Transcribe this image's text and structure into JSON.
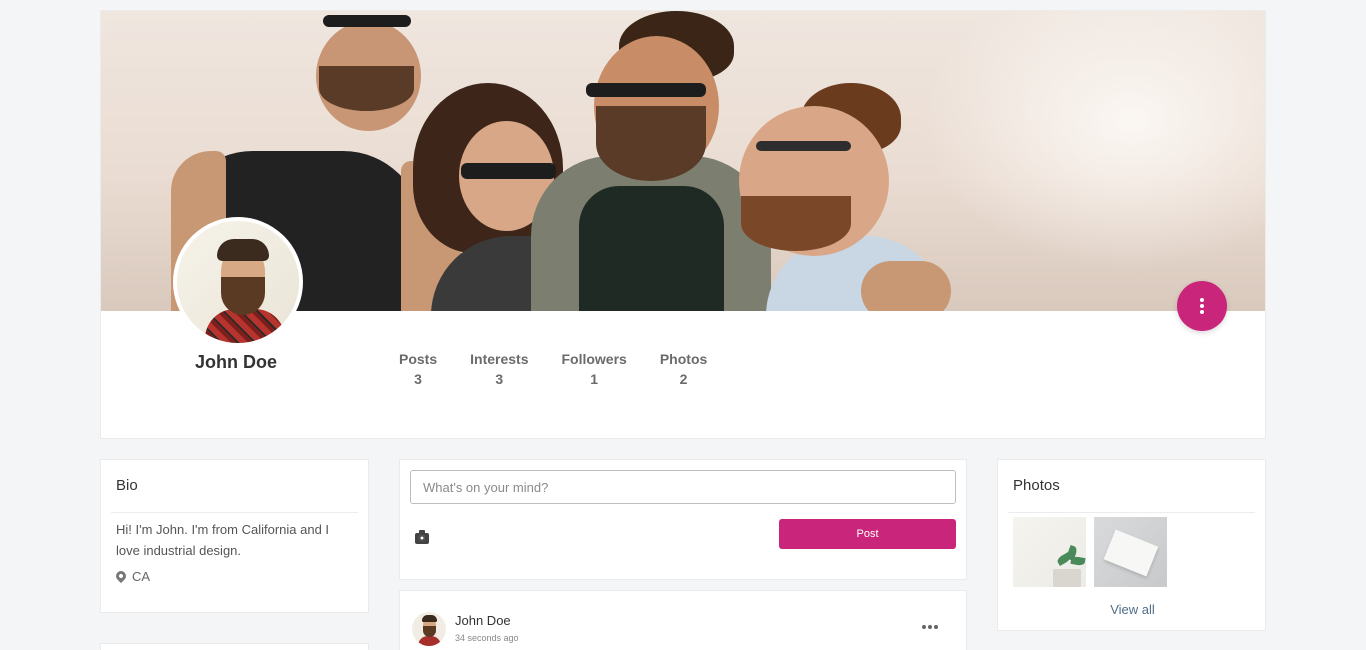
{
  "profile": {
    "name": "John Doe",
    "stats": [
      {
        "label": "Posts",
        "value": "3"
      },
      {
        "label": "Interests",
        "value": "3"
      },
      {
        "label": "Followers",
        "value": "1"
      },
      {
        "label": "Photos",
        "value": "2"
      }
    ]
  },
  "bio": {
    "title": "Bio",
    "text": "Hi! I'm John. I'm from California and I love industrial design.",
    "location": "CA"
  },
  "composer": {
    "placeholder": "What's on your mind?",
    "post_label": "Post"
  },
  "post": {
    "author": "John Doe",
    "time": "34 seconds ago"
  },
  "photos": {
    "title": "Photos",
    "view_all_label": "View all"
  },
  "colors": {
    "accent": "#c9257a",
    "page_bg": "#f4f5f7",
    "link": "#4f6e8a"
  },
  "icons": [
    "more-vertical-icon",
    "map-pin-icon",
    "camera-icon",
    "more-horizontal-icon"
  ]
}
